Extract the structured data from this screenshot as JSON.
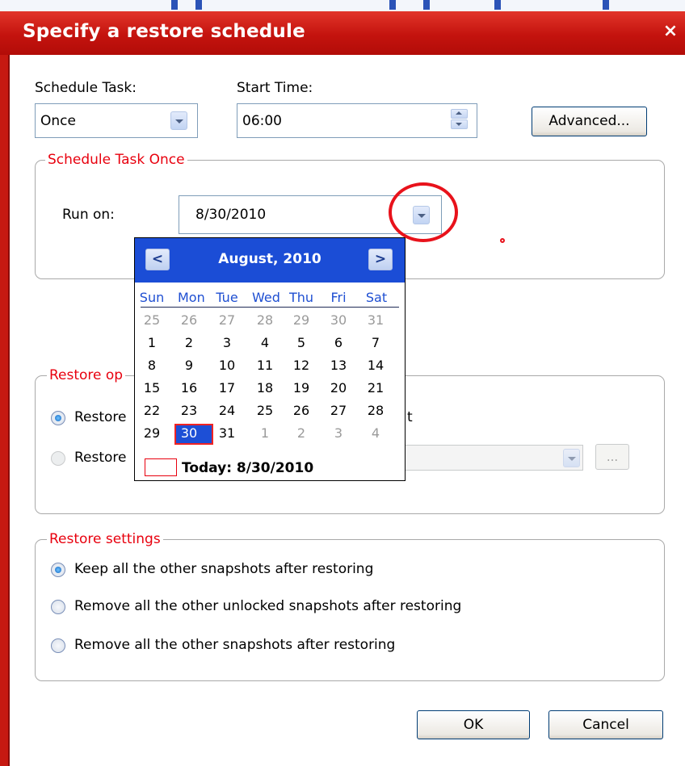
{
  "window": {
    "title": "Specify a restore schedule",
    "close_glyph": "×"
  },
  "schedule": {
    "task_label": "Schedule Task:",
    "task_value": "Once",
    "start_time_label": "Start Time:",
    "start_time_value": "06:00",
    "advanced_label": "Advanced..."
  },
  "once_group": {
    "title": "Schedule Task Once",
    "run_on_label": "Run on:",
    "run_on_value": "8/30/2010"
  },
  "calendar": {
    "month_title": "August, 2010",
    "prev_glyph": "<",
    "next_glyph": ">",
    "weekdays": [
      "Sun",
      "Mon",
      "Tue",
      "Wed",
      "Thu",
      "Fri",
      "Sat"
    ],
    "weeks": [
      [
        "25",
        "26",
        "27",
        "28",
        "29",
        "30",
        "31"
      ],
      [
        "1",
        "2",
        "3",
        "4",
        "5",
        "6",
        "7"
      ],
      [
        "8",
        "9",
        "10",
        "11",
        "12",
        "13",
        "14"
      ],
      [
        "15",
        "16",
        "17",
        "18",
        "19",
        "20",
        "21"
      ],
      [
        "22",
        "23",
        "24",
        "25",
        "26",
        "27",
        "28"
      ],
      [
        "29",
        "30",
        "31",
        "1",
        "2",
        "3",
        "4"
      ]
    ],
    "selected_day": "30",
    "today_label": "Today: 8/30/2010"
  },
  "restore_options": {
    "title_visible": "Restore op",
    "option1_visible": "Restore",
    "option1_trailing": "t",
    "option2_visible": "Restore",
    "browse_label": "..."
  },
  "restore_settings": {
    "title": "Restore settings",
    "options": [
      "Keep all the other snapshots after restoring",
      "Remove all the other unlocked snapshots after restoring",
      "Remove all the other snapshots after restoring"
    ]
  },
  "buttons": {
    "ok": "OK",
    "cancel": "Cancel"
  },
  "colors": {
    "title_bar": "#c4130e",
    "group_title": "#e8000e",
    "calendar_header": "#1b4dd6",
    "weekday_text": "#1f4fd2",
    "annotation": "#e8121b"
  }
}
